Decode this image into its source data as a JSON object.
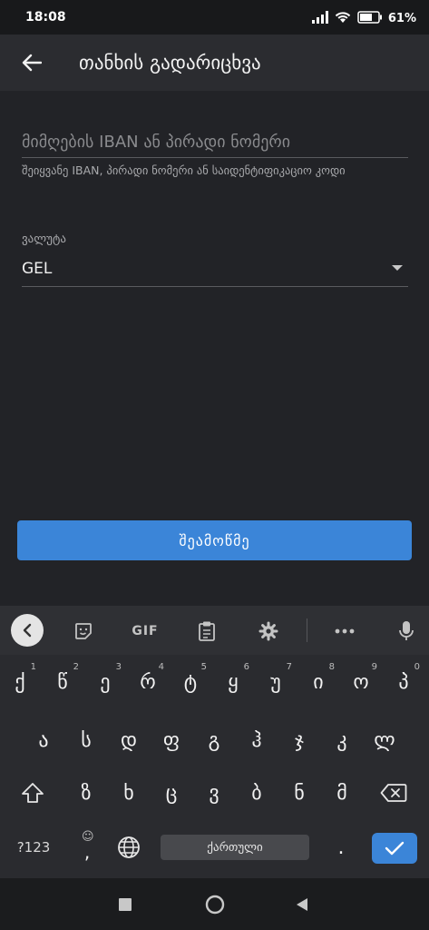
{
  "status_bar": {
    "time": "18:08",
    "battery": "61%"
  },
  "app_bar": {
    "title": "თანხის გადარიცხვა"
  },
  "form": {
    "iban_placeholder": "მიმღების IBAN ან პირადი ნომერი",
    "iban_helper": "შეიყვანე IBAN, პირადი ნომერი ან საიდენტიფიკაციო კოდი",
    "currency_label": "ვალუტა",
    "currency_value": "GEL",
    "check_button": "შეამოწმე"
  },
  "keyboard": {
    "toolbar": {
      "gif": "GIF"
    },
    "row1": [
      {
        "char": "ქ",
        "hint": "1"
      },
      {
        "char": "წ",
        "hint": "2"
      },
      {
        "char": "ე",
        "hint": "3"
      },
      {
        "char": "რ",
        "hint": "4"
      },
      {
        "char": "ტ",
        "hint": "5"
      },
      {
        "char": "ყ",
        "hint": "6"
      },
      {
        "char": "უ",
        "hint": "7"
      },
      {
        "char": "ი",
        "hint": "8"
      },
      {
        "char": "ო",
        "hint": "9"
      },
      {
        "char": "პ",
        "hint": "0"
      }
    ],
    "row2": [
      "ა",
      "ს",
      "დ",
      "ფ",
      "გ",
      "ჰ",
      "ჯ",
      "კ",
      "ლ"
    ],
    "row3": [
      "ზ",
      "ხ",
      "ც",
      "ვ",
      "ბ",
      "ნ",
      "მ"
    ],
    "symbols_key": "?123",
    "comma_key": ",",
    "space_label": "ქართული",
    "period_key": "."
  }
}
